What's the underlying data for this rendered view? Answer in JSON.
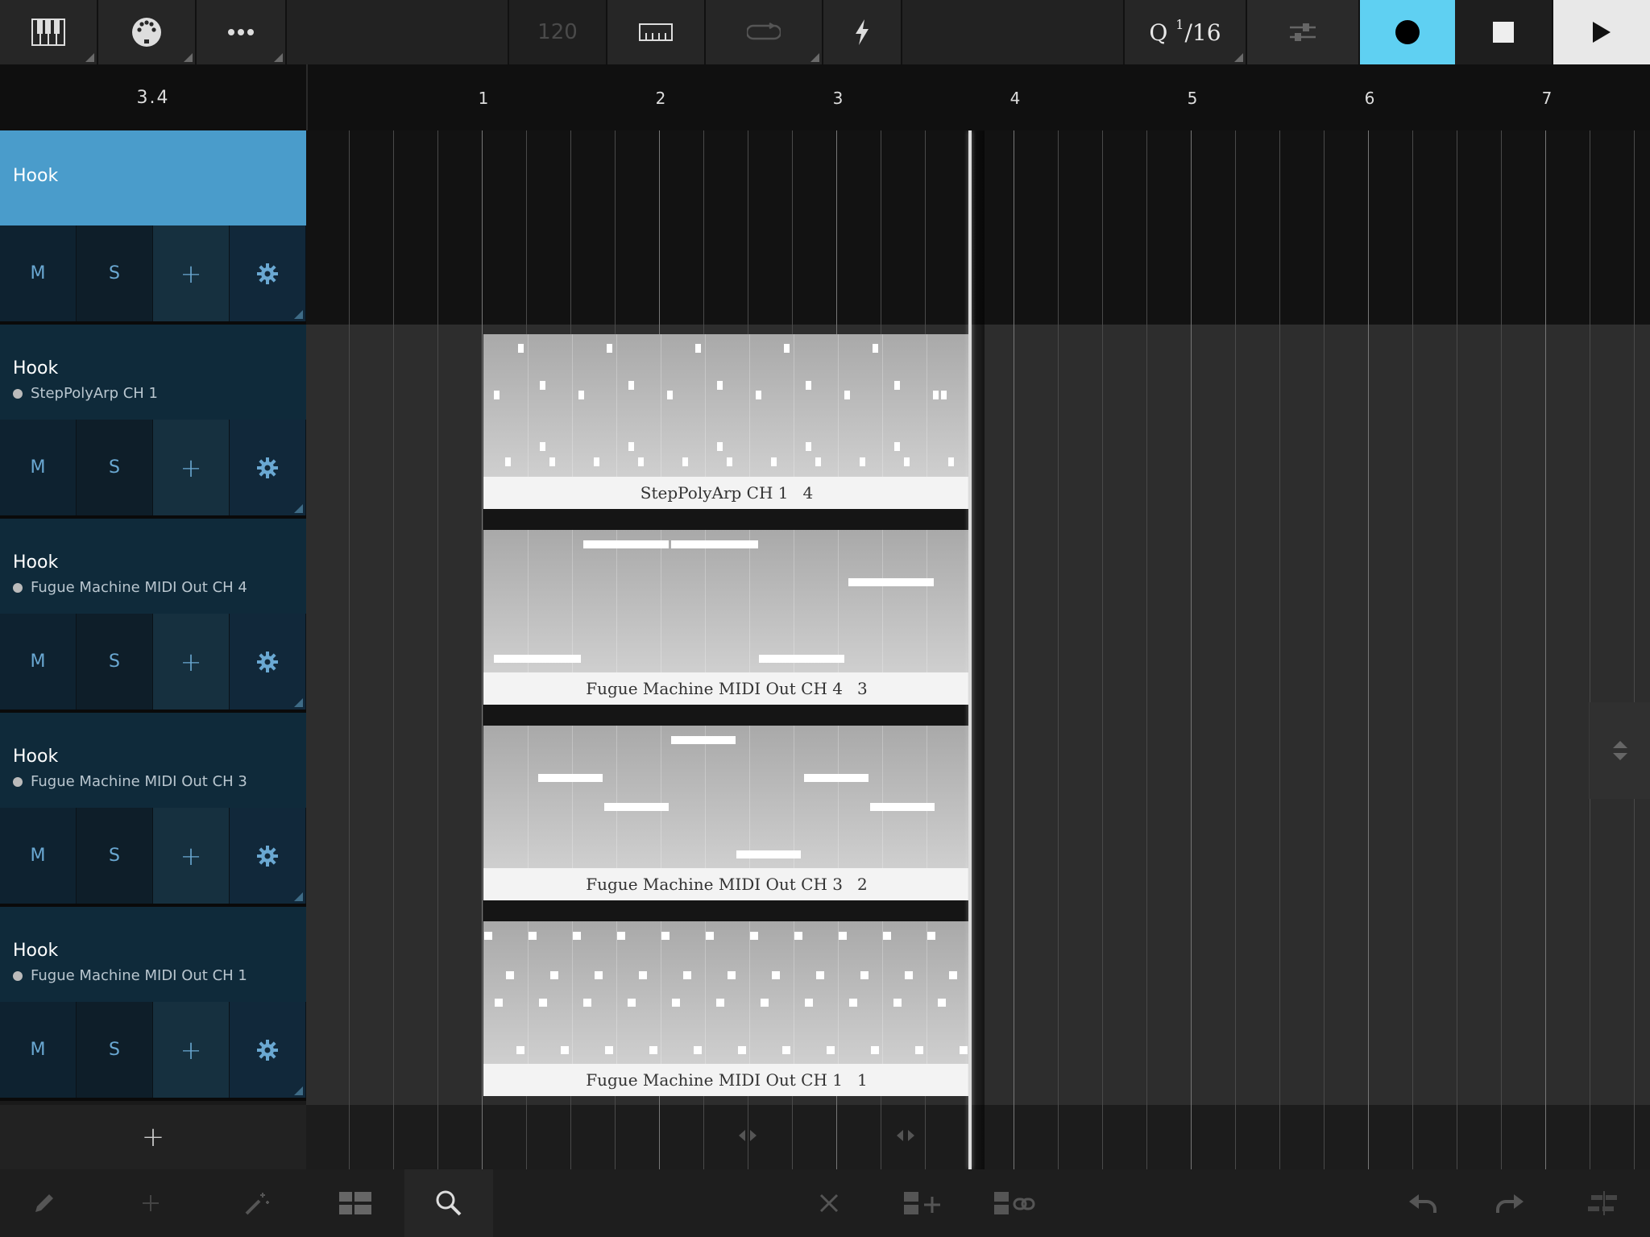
{
  "toolbar": {
    "tempo": "120",
    "quantize_prefix": "Q",
    "quantize_num": "1",
    "quantize_sep": "/",
    "quantize_den": "16",
    "icons": [
      "piano-icon",
      "midi-port-icon",
      "more-icon",
      "ruler-icon",
      "loop-icon",
      "lightning-icon",
      "mixer-icon",
      "record-icon",
      "stop-icon",
      "play-icon"
    ]
  },
  "ruler": {
    "position": "3.4",
    "bars": [
      "1",
      "2",
      "3",
      "4",
      "5",
      "6",
      "7"
    ]
  },
  "tracks": [
    {
      "name": "Hook",
      "subtitle": "",
      "selected": true
    },
    {
      "name": "Hook",
      "subtitle": "StepPolyArp CH 1",
      "selected": false
    },
    {
      "name": "Hook",
      "subtitle": "Fugue Machine MIDI Out CH 4",
      "selected": false
    },
    {
      "name": "Hook",
      "subtitle": "Fugue Machine MIDI Out CH 3",
      "selected": false
    },
    {
      "name": "Hook",
      "subtitle": "Fugue Machine MIDI Out CH 1",
      "selected": false
    }
  ],
  "track_controls": {
    "mute": "M",
    "solo": "S",
    "add": "+",
    "settings": "gear-icon"
  },
  "add_track_label": "+",
  "clips": [
    {
      "name": "StepPolyArp CH 1",
      "number": "4"
    },
    {
      "name": "Fugue Machine MIDI Out CH 4",
      "number": "3"
    },
    {
      "name": "Fugue Machine MIDI Out CH 3",
      "number": "2"
    },
    {
      "name": "Fugue Machine MIDI Out CH 1",
      "number": "1"
    }
  ],
  "bottom_toolbar": {
    "icons": [
      "pencil-icon",
      "add-icon",
      "magic-wand-icon",
      "layout-icon",
      "zoom-icon",
      "delete-icon",
      "duplicate-add-icon",
      "link-clip-icon",
      "undo-icon",
      "redo-icon",
      "split-icon"
    ],
    "active": "zoom-icon"
  },
  "colors": {
    "accent": "#5fd0f2",
    "selected_track": "#4a9ccb",
    "track_bg": "#0f2a3a",
    "control_text": "#6aa8d2"
  }
}
